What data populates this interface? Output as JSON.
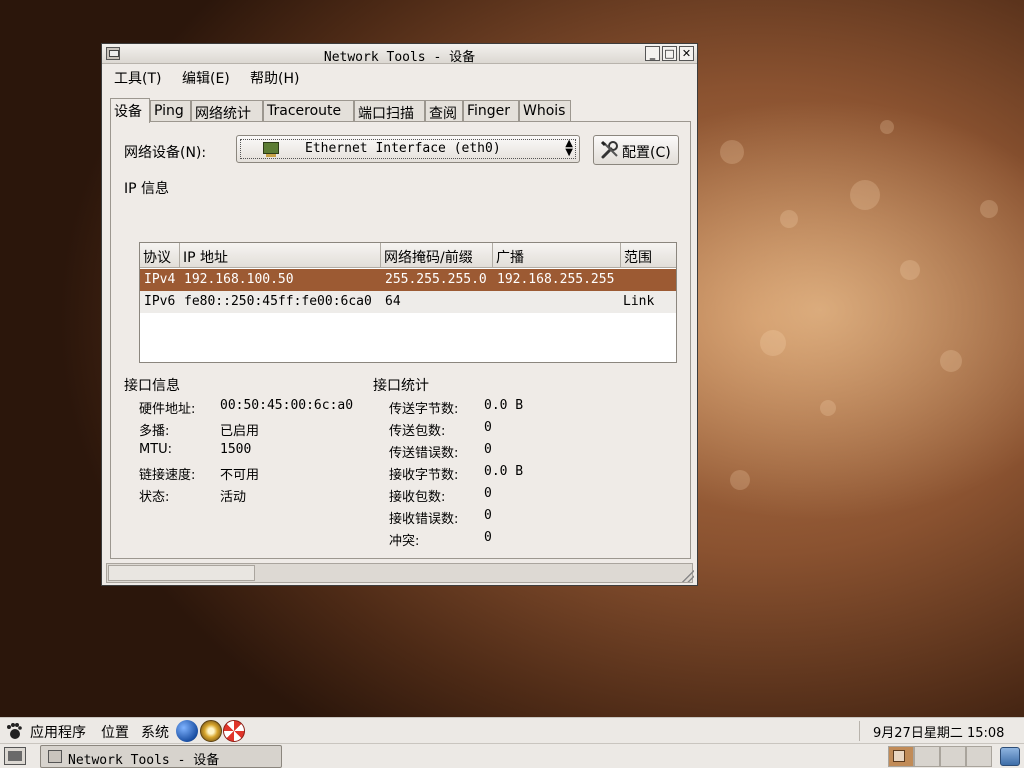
{
  "window": {
    "title": "Network Tools - 设备",
    "minimize": "_",
    "maximize": "□",
    "close": "✕"
  },
  "menubar": [
    {
      "label": "工具(T)"
    },
    {
      "label": "编辑(E)"
    },
    {
      "label": "帮助(H)"
    }
  ],
  "tabs": [
    {
      "label": "设备",
      "active": true
    },
    {
      "label": "Ping"
    },
    {
      "label": "网络统计"
    },
    {
      "label": "Traceroute"
    },
    {
      "label": "端口扫描"
    },
    {
      "label": "查阅"
    },
    {
      "label": "Finger"
    },
    {
      "label": "Whois"
    }
  ],
  "device": {
    "label": "网络设备(N):",
    "selected": "Ethernet Interface (eth0)",
    "configure_label": "配置(C)"
  },
  "ip_info": {
    "section_label": "IP 信息",
    "columns": [
      "协议",
      "IP 地址",
      "网络掩码/前缀",
      "广播",
      "范围"
    ],
    "rows": [
      {
        "protocol": "IPv4",
        "address": "192.168.100.50",
        "netmask": "255.255.255.0",
        "broadcast": "192.168.255.255",
        "scope": "",
        "selected": true
      },
      {
        "protocol": "IPv6",
        "address": "fe80::250:45ff:fe00:6ca0",
        "netmask": "64",
        "broadcast": "",
        "scope": "Link",
        "selected": false
      }
    ]
  },
  "interface_info": {
    "section_label": "接口信息",
    "items": [
      {
        "key": "硬件地址:",
        "value": "00:50:45:00:6c:a0"
      },
      {
        "key": "多播:",
        "value": "已启用"
      },
      {
        "key": "MTU:",
        "value": "1500"
      },
      {
        "key": "链接速度:",
        "value": "不可用"
      },
      {
        "key": "状态:",
        "value": "活动"
      }
    ]
  },
  "interface_stats": {
    "section_label": "接口统计",
    "items": [
      {
        "key": "传送字节数:",
        "value": "0.0 B"
      },
      {
        "key": "传送包数:",
        "value": "0"
      },
      {
        "key": "传送错误数:",
        "value": "0"
      },
      {
        "key": "接收字节数:",
        "value": "0.0 B"
      },
      {
        "key": "接收包数:",
        "value": "0"
      },
      {
        "key": "接收错误数:",
        "value": "0"
      },
      {
        "key": "冲突:",
        "value": "0"
      }
    ]
  },
  "top_panel": {
    "menus": [
      "应用程序",
      "位置",
      "系统"
    ],
    "clock": "9月27日星期二 15:08"
  },
  "bottom_panel": {
    "task_title": "Network Tools - 设备"
  },
  "colors": {
    "selection": "#9c5a33",
    "window_bg": "#efebe7"
  }
}
